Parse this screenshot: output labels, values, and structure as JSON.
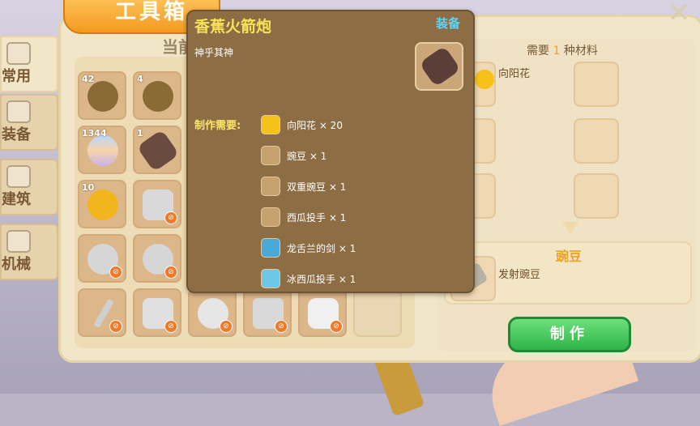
{
  "window": {
    "title": "工具箱",
    "close_icon": "✕"
  },
  "categories": [
    {
      "label": "常用",
      "icon": "box-icon",
      "active": true
    },
    {
      "label": "装备",
      "icon": "armor-icon",
      "active": false
    },
    {
      "label": "建筑",
      "icon": "house-icon",
      "active": false
    },
    {
      "label": "机械",
      "icon": "gears-icon",
      "active": false
    }
  ],
  "left_panel": {
    "header": "当前材料可制作："
  },
  "inventory": [
    {
      "count": "42",
      "icon": "sunflower-seed-bag-icon",
      "blocked": false
    },
    {
      "count": "4",
      "icon": "flower-seed-bag-icon",
      "blocked": false
    },
    {
      "count": "1344",
      "icon": "striped-egg-icon",
      "blocked": false
    },
    {
      "count": "1",
      "icon": "banana-rocket-icon",
      "blocked": false
    },
    {
      "count": "10",
      "icon": "gold-bag-icon",
      "blocked": false
    },
    {
      "count": "",
      "icon": "bowl-icon",
      "blocked": true
    },
    {
      "count": "",
      "icon": "snail-shell-icon",
      "blocked": true
    },
    {
      "count": "",
      "icon": "snail-shell-icon",
      "blocked": true
    },
    {
      "count": "",
      "icon": "spear-icon",
      "blocked": true
    },
    {
      "count": "",
      "icon": "cannon-icon",
      "blocked": true
    },
    {
      "count": "",
      "icon": "acorn-icon",
      "blocked": true
    },
    {
      "count": "",
      "icon": "crossbow-icon",
      "blocked": true
    },
    {
      "count": "",
      "icon": "drill-icon",
      "blocked": true
    }
  ],
  "tooltip": {
    "name": "香蕉火箭炮",
    "equip_label": "装备",
    "description": "神乎其神",
    "requirements_label": "制作需要:",
    "requirements": [
      {
        "text": "向阳花 × 20",
        "icon": "sunflower-icon"
      },
      {
        "text": "豌豆 × 1",
        "icon": "pea-gun-icon"
      },
      {
        "text": "双重豌豆 × 1",
        "icon": "double-pea-icon"
      },
      {
        "text": "西瓜投手 × 1",
        "icon": "melon-pult-icon"
      },
      {
        "text": "龙舌兰的剑 × 1",
        "icon": "agave-sword-icon"
      },
      {
        "text": "冰西瓜投手 × 1",
        "icon": "ice-melon-icon"
      }
    ]
  },
  "right_panel": {
    "need_prefix": "需要",
    "need_count": "1",
    "need_suffix": "种材料",
    "material": {
      "label": "向阳花",
      "icon": "sunflower-icon"
    },
    "result_title": "豌豆",
    "result_label": "发射豌豆",
    "result_icon": "pea-gun-icon",
    "craft_button": "制作"
  },
  "colors": {
    "accent_orange": "#f39a1f",
    "tooltip_bg": "#8c6d44",
    "craft_green": "#2fb44a",
    "equip_blue": "#58d6ff"
  }
}
